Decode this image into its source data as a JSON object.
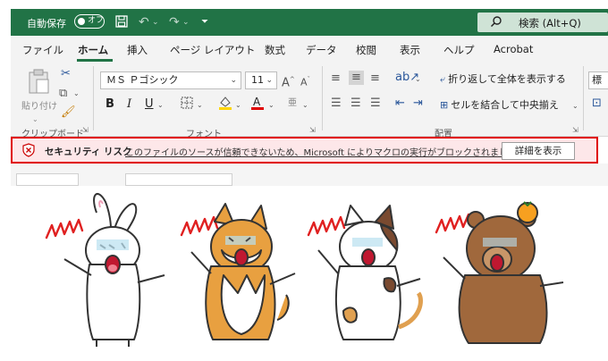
{
  "titlebar": {
    "autosave_label": "自動保存",
    "autosave_state": "オフ",
    "search_label": "検索 (Alt+Q)",
    "icons": [
      "save-icon",
      "undo-icon",
      "redo-icon",
      "customize-quick-access-icon",
      "search-icon"
    ]
  },
  "tabs": [
    {
      "label": "ファイル"
    },
    {
      "label": "ホーム",
      "active": true
    },
    {
      "label": "挿入"
    },
    {
      "label": "ページ レイアウト"
    },
    {
      "label": "数式"
    },
    {
      "label": "データ"
    },
    {
      "label": "校閲"
    },
    {
      "label": "表示"
    },
    {
      "label": "ヘルプ"
    },
    {
      "label": "Acrobat"
    }
  ],
  "ribbon": {
    "paste_label": "貼り付け",
    "font_name": "ＭＳ Ｐゴシック",
    "font_size": "11",
    "wrap_text": "折り返して全体を表示する",
    "merge_center": "セルを結合して中央揃え",
    "groups": {
      "clipboard": "クリップボード",
      "font": "フォント",
      "alignment": "配置"
    },
    "standard_partial": "標"
  },
  "security": {
    "title": "セキュリティ リスク",
    "message": "このファイルのソースが信頼できないため、Microsoft によりマクロの実行がブロックされました。",
    "detail_button": "詳細を表示"
  },
  "colors": {
    "excel_green": "#217346",
    "warning_border": "#e00000",
    "warning_bg": "#fde7e9"
  }
}
